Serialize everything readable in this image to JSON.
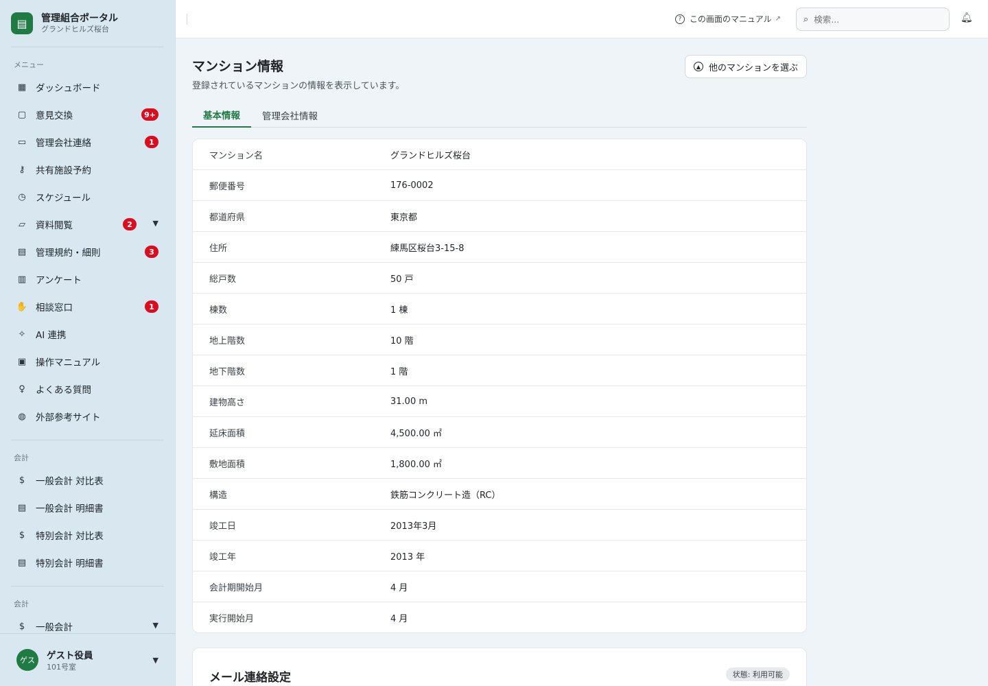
{
  "brand": {
    "title": "管理組合ポータル",
    "subtitle": "グランドヒルズ桜台"
  },
  "sidebar": {
    "menu_label": "メニュー",
    "items": [
      {
        "label": "ダッシュボード",
        "icon": "dashboard-icon",
        "glyph": "▦"
      },
      {
        "label": "意見交換",
        "icon": "chat-icon",
        "glyph": "▢",
        "badge": "9+"
      },
      {
        "label": "管理会社連絡",
        "icon": "briefcase-icon",
        "glyph": "▭",
        "badge": "1"
      },
      {
        "label": "共有施設予約",
        "icon": "key-icon",
        "glyph": "⚷"
      },
      {
        "label": "スケジュール",
        "icon": "calendar-icon",
        "glyph": "◷"
      },
      {
        "label": "資料閲覧",
        "icon": "folder-icon",
        "glyph": "▱",
        "badge": "2",
        "expand": true
      },
      {
        "label": "管理規約・細則",
        "icon": "book-icon",
        "glyph": "▤",
        "badge": "3"
      },
      {
        "label": "アンケート",
        "icon": "clipboard-icon",
        "glyph": "▥"
      },
      {
        "label": "相談窓口",
        "icon": "hand-icon",
        "glyph": "✋",
        "badge": "1"
      },
      {
        "label": "AI 連携",
        "icon": "sparkle-icon",
        "glyph": "✧"
      },
      {
        "label": "操作マニュアル",
        "icon": "manual-icon",
        "glyph": "▣"
      },
      {
        "label": "よくある質問",
        "icon": "lightbulb-icon",
        "glyph": "♀"
      },
      {
        "label": "外部参考サイト",
        "icon": "globe-icon",
        "glyph": "◍"
      }
    ],
    "accounting_label": "会計",
    "accounting_items": [
      {
        "label": "一般会計 対比表",
        "icon": "dollar-icon",
        "glyph": "$"
      },
      {
        "label": "一般会計 明細書",
        "icon": "document-icon",
        "glyph": "▤"
      },
      {
        "label": "特別会計 対比表",
        "icon": "dollar-icon",
        "glyph": "$"
      },
      {
        "label": "特別会計 明細書",
        "icon": "document-icon",
        "glyph": "▤"
      }
    ],
    "accounting2_label": "会計",
    "accounting2_items": [
      {
        "label": "一般会計",
        "icon": "dollar-icon",
        "glyph": "$",
        "expand": true
      }
    ]
  },
  "user": {
    "avatar": "ゲス",
    "name": "ゲスト役員",
    "room": "101号室"
  },
  "header": {
    "manual_label": "この画面のマニュアル",
    "search_placeholder": "検索..."
  },
  "page": {
    "title": "マンション情報",
    "description": "登録されているマンションの情報を表示しています。",
    "select_button": "他のマンションを選ぶ",
    "tabs": [
      "基本情報",
      "管理会社情報"
    ]
  },
  "info_rows": [
    {
      "key": "マンション名",
      "value": "グランドヒルズ桜台"
    },
    {
      "key": "郵便番号",
      "value": "176-0002"
    },
    {
      "key": "都道府県",
      "value": "東京都"
    },
    {
      "key": "住所",
      "value": "練馬区桜台3-15-8"
    },
    {
      "key": "総戸数",
      "value": "50 戸"
    },
    {
      "key": "棟数",
      "value": "1 棟"
    },
    {
      "key": "地上階数",
      "value": "10 階"
    },
    {
      "key": "地下階数",
      "value": "1 階"
    },
    {
      "key": "建物高さ",
      "value": "31.00 m"
    },
    {
      "key": "延床面積",
      "value": "4,500.00 ㎡"
    },
    {
      "key": "敷地面積",
      "value": "1,800.00 ㎡"
    },
    {
      "key": "構造",
      "value": "鉄筋コンクリート造（RC）"
    },
    {
      "key": "竣工日",
      "value": "2013年3月"
    },
    {
      "key": "竣工年",
      "value": "2013 年"
    },
    {
      "key": "会計期開始月",
      "value": "4 月"
    },
    {
      "key": "実行開始月",
      "value": "4 月"
    }
  ],
  "mail_section": {
    "title": "メール連絡設定",
    "status": "状態: 利用可能"
  }
}
